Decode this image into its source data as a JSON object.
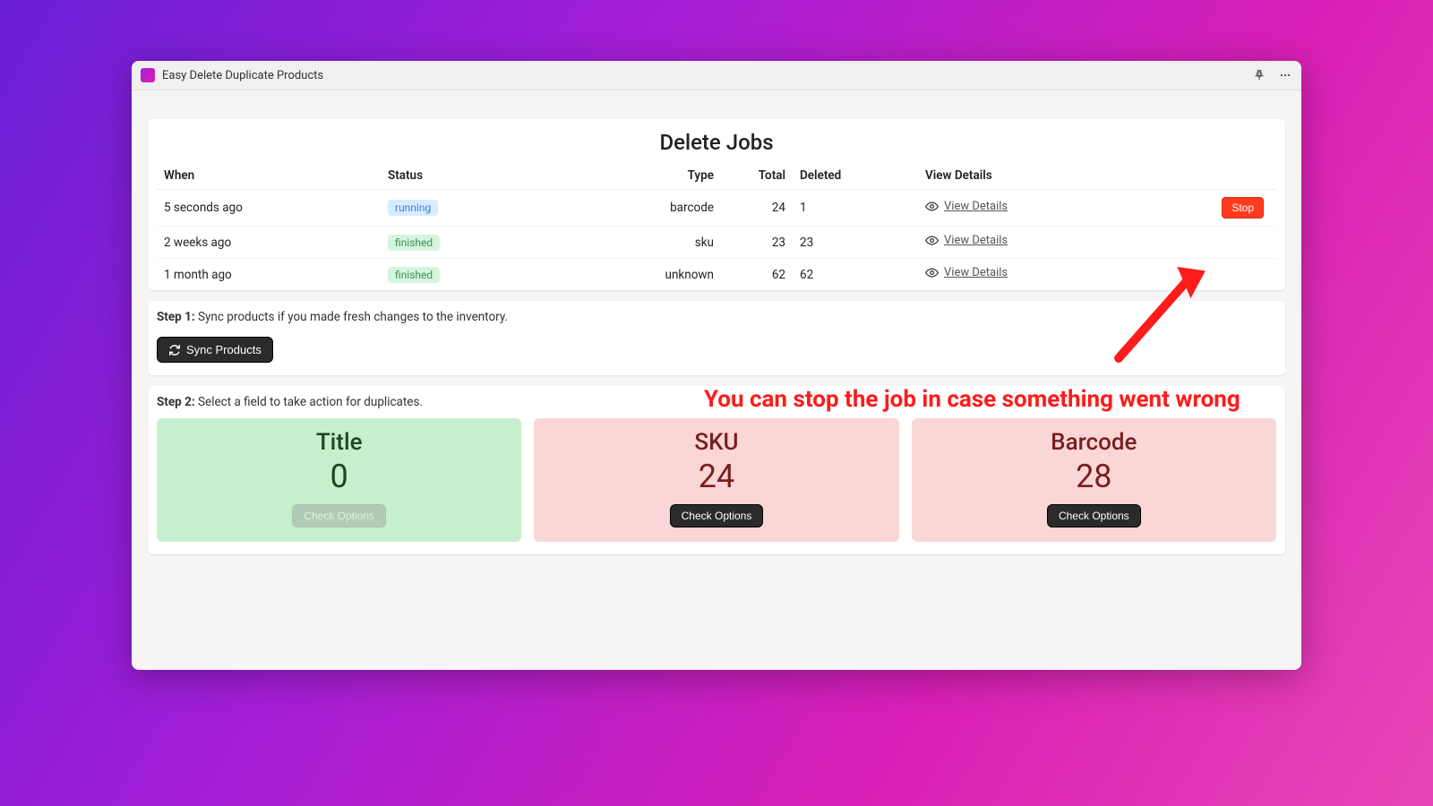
{
  "titlebar": {
    "title": "Easy Delete Duplicate Products"
  },
  "jobs": {
    "heading": "Delete Jobs",
    "columns": {
      "when": "When",
      "status": "Status",
      "type": "Type",
      "total": "Total",
      "deleted": "Deleted",
      "view": "View Details"
    },
    "rows": [
      {
        "when": "5 seconds ago",
        "status": "running",
        "type": "barcode",
        "total": "24",
        "deleted": "1",
        "view": "View Details",
        "stop": "Stop"
      },
      {
        "when": "2 weeks ago",
        "status": "finished",
        "type": "sku",
        "total": "23",
        "deleted": "23",
        "view": "View Details"
      },
      {
        "when": "1 month ago",
        "status": "finished",
        "type": "unknown",
        "total": "62",
        "deleted": "62",
        "view": "View Details"
      }
    ]
  },
  "step1": {
    "label_bold": "Step 1:",
    "label_rest": " Sync products if you made fresh changes to the inventory.",
    "button": "Sync Products"
  },
  "step2": {
    "label_bold": "Step 2:",
    "label_rest": " Select a field to take action for duplicates.",
    "check_label": "Check Options",
    "cards": [
      {
        "title": "Title",
        "count": "0",
        "tone": "green",
        "disabled": true
      },
      {
        "title": "SKU",
        "count": "24",
        "tone": "pink",
        "disabled": false
      },
      {
        "title": "Barcode",
        "count": "28",
        "tone": "pink",
        "disabled": false
      }
    ]
  },
  "annotation": {
    "text": "You can stop the job in case something went wrong"
  }
}
